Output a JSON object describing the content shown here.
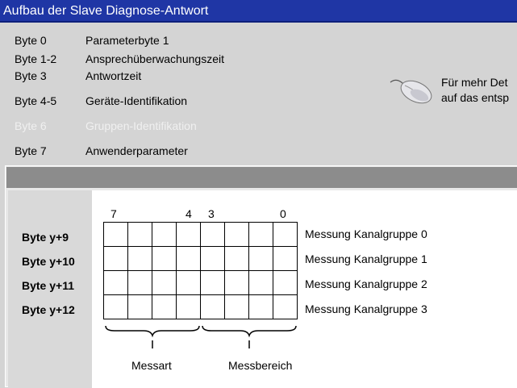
{
  "title": "Aufbau der Slave Diagnose-Antwort",
  "rows": [
    {
      "key": "Byte 0",
      "value": "Parameterbyte 1"
    },
    {
      "key": "Byte 1-2",
      "value": "Ansprechüberwachungszeit"
    },
    {
      "key": "Byte 3",
      "value": "Antwortzeit"
    },
    {
      "key": "Byte 4-5",
      "value": "Geräte-Identifikation"
    },
    {
      "key": "Byte 6",
      "value": "Gruppen-Identifikation"
    },
    {
      "key": "Byte 7",
      "value": "Anwenderparameter"
    }
  ],
  "hint": {
    "line1": "Für mehr Det",
    "line2": "auf das entsp",
    "icon": "mouse-icon"
  },
  "diagram": {
    "bit_numbers": [
      "7",
      "4",
      "3",
      "0"
    ],
    "byte_labels": [
      "Byte y+9",
      "Byte y+10",
      "Byte y+11",
      "Byte y+12"
    ],
    "measurements": [
      "Messung Kanalgruppe 0",
      "Messung Kanalgruppe 1",
      "Messung Kanalgruppe 2",
      "Messung Kanalgruppe 3"
    ],
    "groups": [
      "Messart",
      "Messbereich"
    ]
  },
  "colors": {
    "title_bar": "#1f36a5",
    "background": "#d4d4d4",
    "panel_bar": "#8c8c8c"
  }
}
